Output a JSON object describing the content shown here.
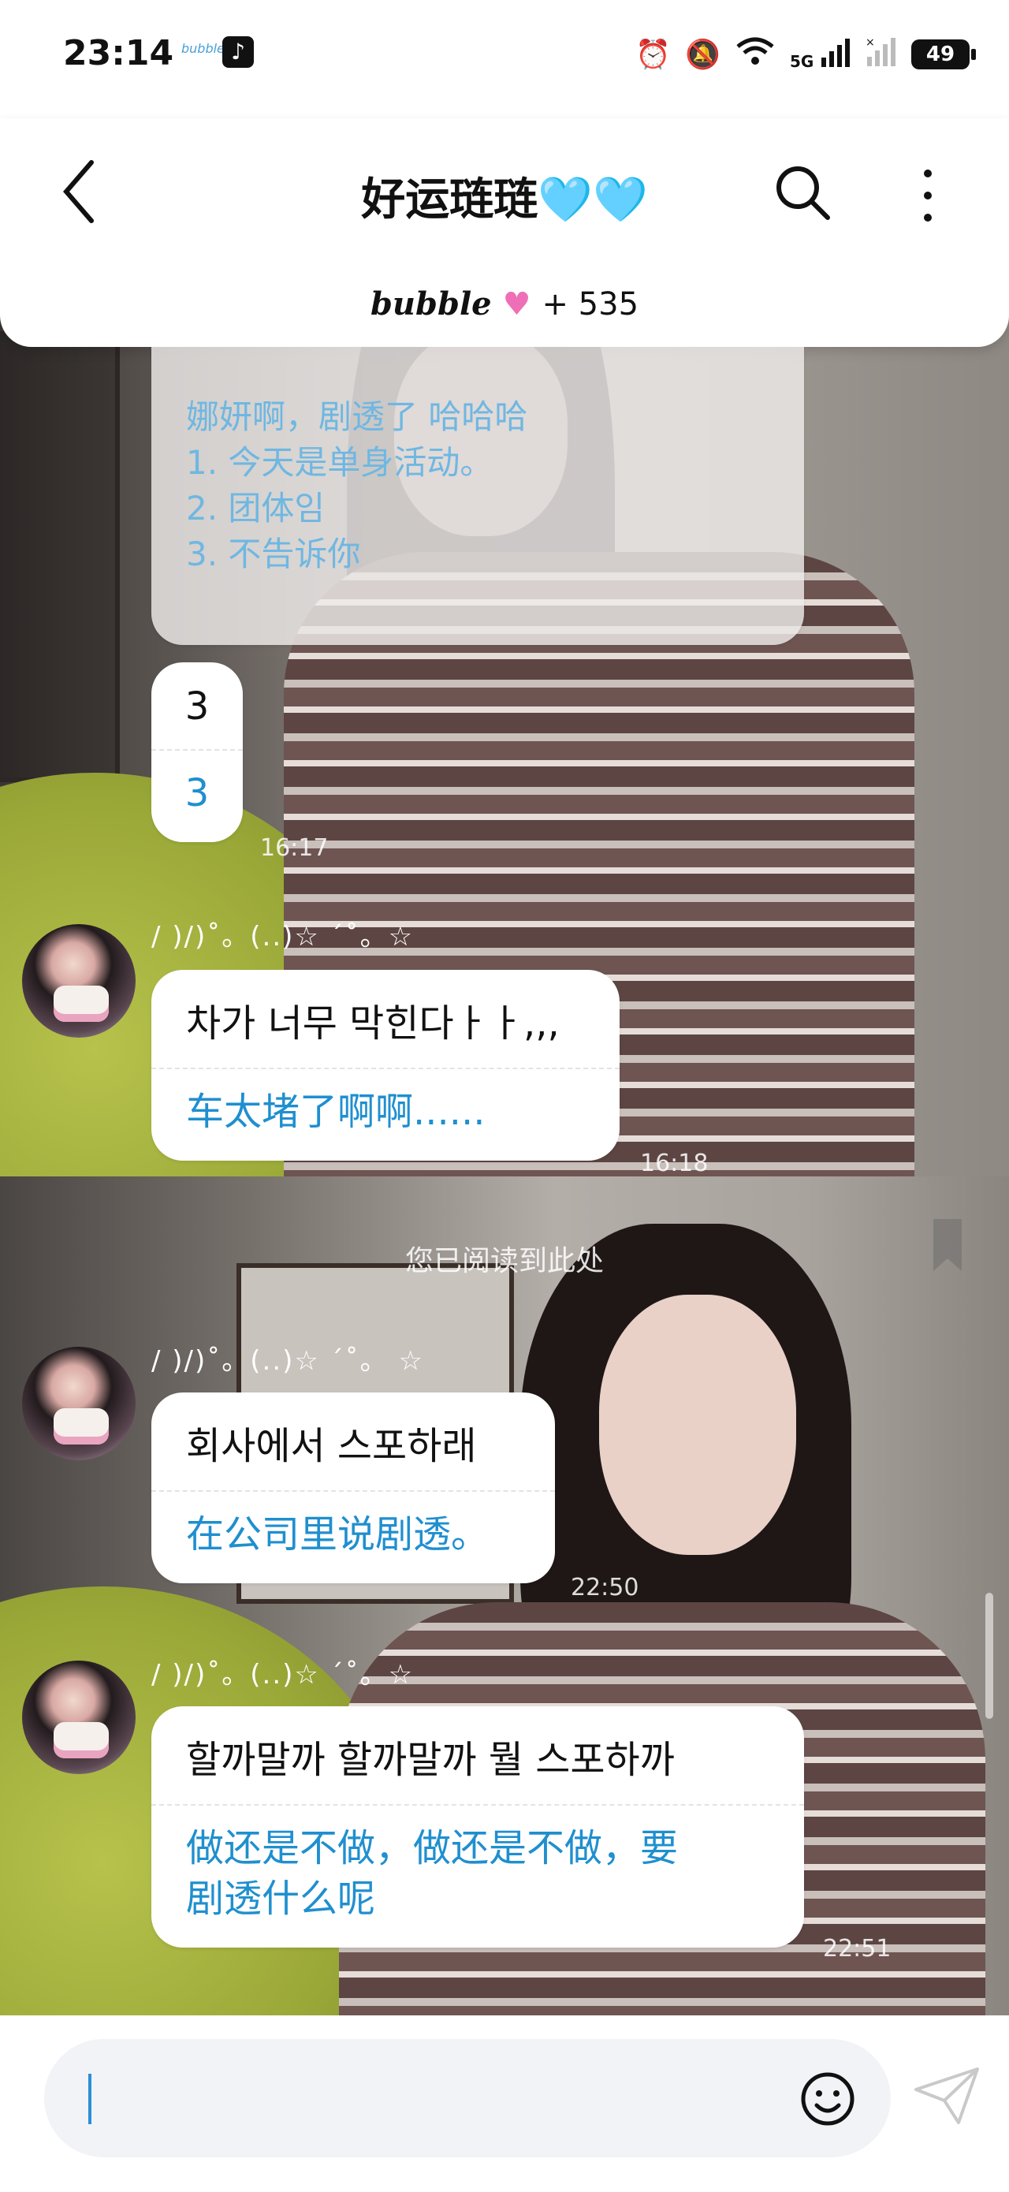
{
  "status_bar": {
    "time": "23:14",
    "app_mini_label": "bubble",
    "network": "5G",
    "battery": "49"
  },
  "header": {
    "title": "好运琏琏",
    "title_hearts": "🩵🩵",
    "brand": "bubble",
    "count": "+ 535"
  },
  "messages": [
    {
      "id": "m0",
      "partial": true,
      "translation": "娜妍啊，剧透了 哈哈哈\n1. 今天是单身活动。\n2. 团体임\n3. 不告诉你"
    },
    {
      "id": "m1",
      "original": "3",
      "translation": "3",
      "time": "16:17"
    },
    {
      "id": "m2",
      "nickname": "/ )/)˚。(..)☆ ´˚。☆",
      "original": "차가 너무 막힌다ㅏㅏ,,,",
      "translation": "车太堵了啊啊......",
      "time": "16:18"
    },
    {
      "id": "m3",
      "nickname": "/ )/)˚。(..)☆ ´˚。 ☆",
      "original": "회사에서 스포하래",
      "translation": "在公司里说剧透。",
      "time": "22:50"
    },
    {
      "id": "m4",
      "nickname": "/ )/)˚。(..)☆ ´˚。☆",
      "original": "할까말까 할까말까 뭘 스포하까",
      "translation": "做还是不做，做还是不做，要\n剧透什么呢",
      "time": "22:51"
    }
  ],
  "read_marker": "您已阅读到此处",
  "input": {
    "placeholder": ""
  },
  "colors": {
    "accent": "#1f8fcf",
    "heart_pink": "#ef6fb6",
    "heart_blue": "#5bc7ef"
  }
}
